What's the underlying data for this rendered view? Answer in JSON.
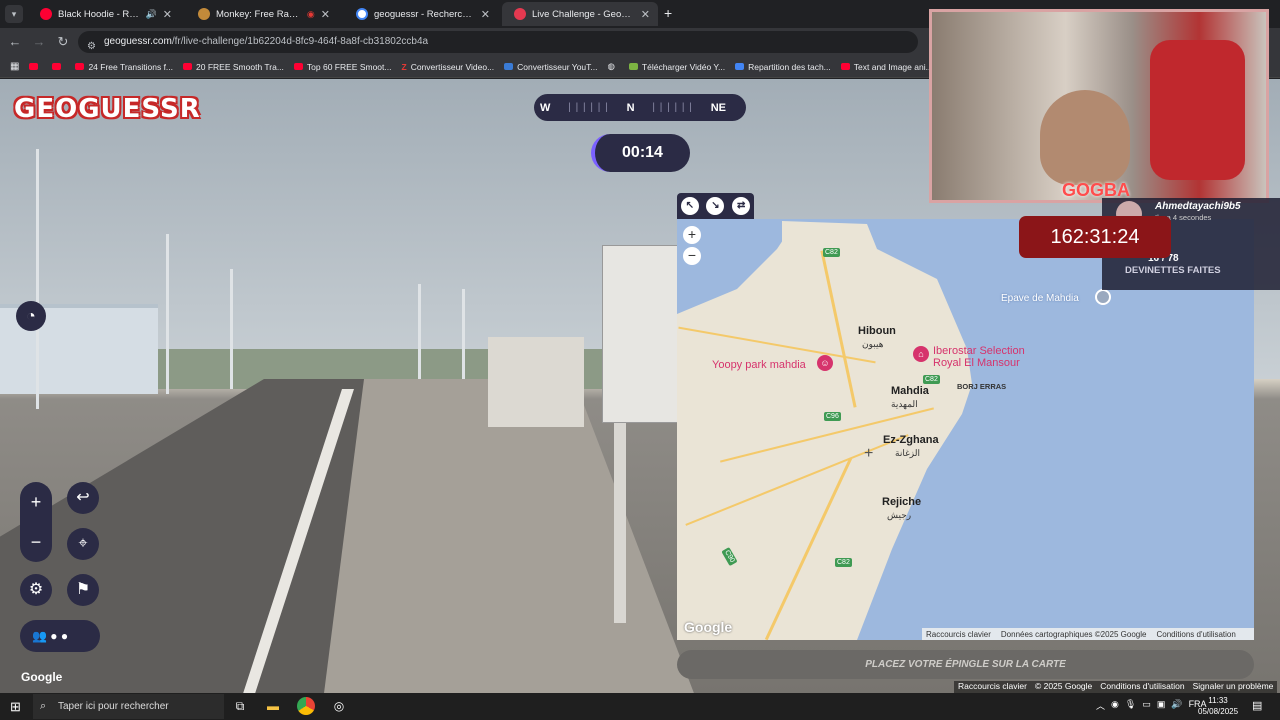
{
  "tabs": [
    {
      "title": "Black Hoodie - Requin ft Kh",
      "color": "#ff0033",
      "audio": true
    },
    {
      "title": "Monkey: Free Random Vide",
      "color": "#c28a3a",
      "recording": true
    },
    {
      "title": "geoguessr - Recherche Google",
      "color": "#4285f4"
    },
    {
      "title": "Live Challenge - GeoGuessr",
      "color": "#e53950",
      "active": true
    }
  ],
  "address": {
    "host": "geoguessr.com",
    "path": "/fr/live-challenge/1b62204d-8fc9-464f-8a8f-cb31802ccb4a"
  },
  "bookmarks": [
    "",
    "",
    "24 Free Transitions f...",
    "20 FREE Smooth Tra...",
    "Top 60 FREE Smoot...",
    "Convertisseur Video...",
    "Convertisseur YouT...",
    "",
    "Télécharger Vidéo Y...",
    "Repartition des tach...",
    "Text and Image ani..."
  ],
  "game": {
    "logo": "GEOGUESSR",
    "compass": {
      "left": "W",
      "center": "N",
      "right": "NE"
    },
    "timer": "00:14",
    "place_button": "PLACEZ VOTRE ÉPINGLE SUR LA CARTE",
    "google_logo": "Google"
  },
  "map": {
    "labels": {
      "hiboun": "Hiboun",
      "hiboun_ar": "هيبون",
      "mahdia": "Mahdia",
      "mahdia_ar": "المهدية",
      "ezzghana": "Ez-Zghana",
      "ezzghana_ar": "الزغانة",
      "rejiche": "Rejiche",
      "rejiche_ar": "رجيش",
      "borj": "BORJ ERRAS",
      "yoopy": "Yoopy park mahdia",
      "iberostar1": "Iberostar Selection",
      "iberostar2": "Royal El Mansour",
      "epave": "Epave de Mahdia"
    },
    "roads": {
      "c82a": "C82",
      "c82b": "C82",
      "c82c": "C82",
      "c96": "C96",
      "c90": "C90"
    },
    "google_logo": "Google",
    "footer": [
      "Raccourcis clavier",
      "Données cartographiques ©2025 Google",
      "Conditions d'utilisation"
    ]
  },
  "stream": {
    "webcam_tag": "GOGBA",
    "user_name": "Ahmedtayachi9b5",
    "user_sub": "Il y a 4 secondes",
    "guess_count": "16 / 78",
    "guess_label": "DEVINETTES FAITES",
    "big_timer": "162:31:24"
  },
  "page_footer": [
    "Raccourcis clavier",
    "© 2025 Google",
    "Conditions d'utilisation",
    "Signaler un problème"
  ],
  "taskbar": {
    "search_placeholder": "Taper ici pour rechercher",
    "lang": "FRA",
    "time": "11:33",
    "date": "05/08/2025"
  }
}
